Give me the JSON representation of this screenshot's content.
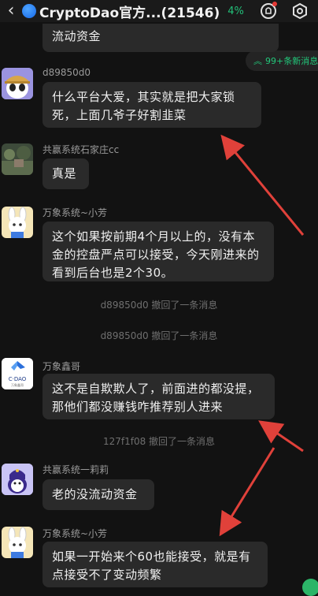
{
  "header": {
    "title": "CryptoDao官方...(21546)",
    "percent": "4%"
  },
  "new_messages": "99+条新消息",
  "messages": [
    {
      "text": "流动资金"
    },
    {
      "sender": "d89850d0",
      "text": "什么平台大爱，其实就是把大家锁死，上面几爷子好割韭菜"
    },
    {
      "sender": "共赢系统石家庄cc",
      "text": "真是"
    },
    {
      "sender": "万象系统~小芳",
      "text": "这个如果按前期4个月以上的，没有本金的控盘严点可以接受，今天刚进来的看到后台也是2个30。"
    },
    {
      "sender": "万象鑫哥",
      "text": "这不是自欺欺人了，前面进的都没提，那他们都没赚钱咋推荐别人进来"
    },
    {
      "sender": "共赢系统一莉莉",
      "text": "老的没流动资金"
    },
    {
      "sender": "万象系统~小芳",
      "text": "如果一开始来个60也能接受，就是有点接受不了变动频繁"
    }
  ],
  "system": [
    "d89850d0 撤回了一条消息",
    "d89850d0 撤回了一条消息",
    "127f1f08 撤回了一条消息"
  ],
  "avatar_labels": {
    "cdao": "C·DAO",
    "cdao_sub": "万象鑫哥"
  },
  "colors": {
    "background": "#121212",
    "bubble": "#2a2a2a",
    "accent": "#23c17a",
    "arrow": "#e0413a"
  },
  "icons": [
    "back-chevron",
    "blue-circle",
    "notification-bell-icon",
    "settings-gear-icon",
    "chevron-up-icon"
  ]
}
